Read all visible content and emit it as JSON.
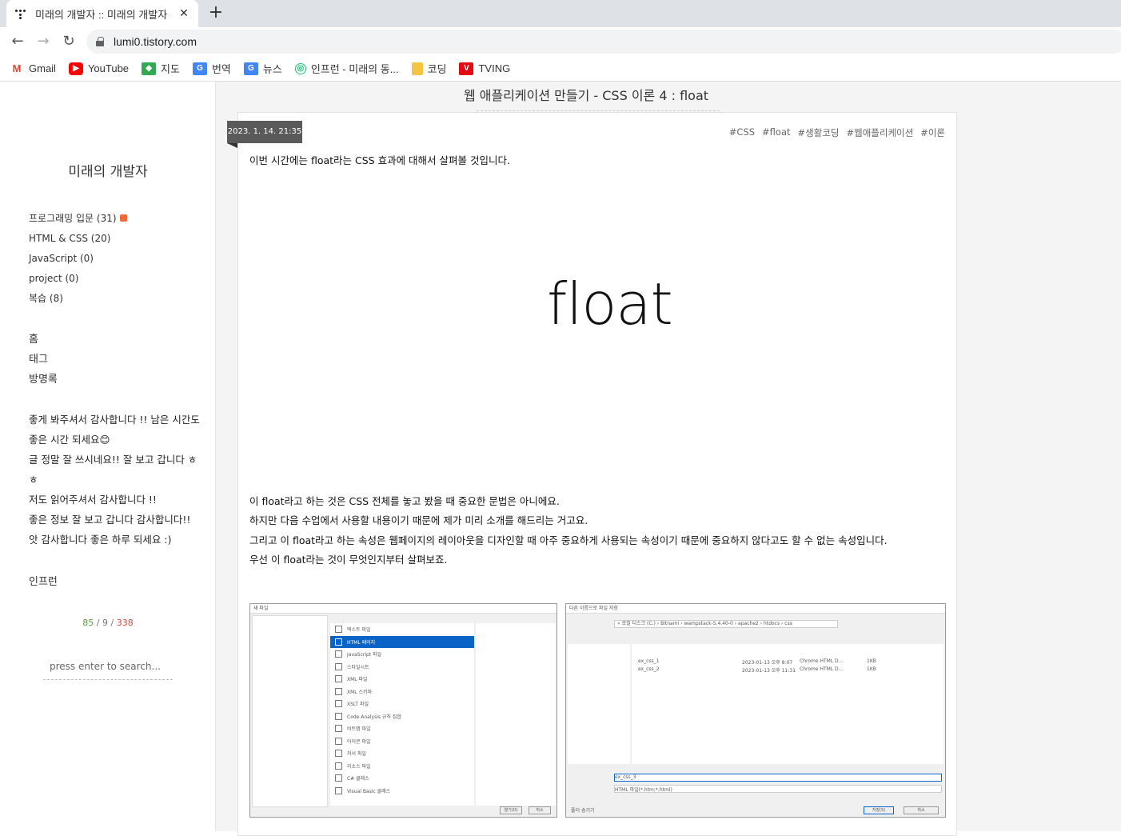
{
  "browser": {
    "tab_title": "미래의 개발자 :: 미래의 개발자",
    "url": "lumi0.tistory.com",
    "bookmarks": [
      {
        "label": "Gmail",
        "icon": "gmail-icon",
        "color": "#ea4335"
      },
      {
        "label": "YouTube",
        "icon": "youtube-icon",
        "color": "#ff0000"
      },
      {
        "label": "지도",
        "icon": "maps-icon",
        "color": "#34a853"
      },
      {
        "label": "번역",
        "icon": "translate-icon",
        "color": "#4285f4"
      },
      {
        "label": "뉴스",
        "icon": "news-icon",
        "color": "#4285f4"
      },
      {
        "label": "인프런 - 미래의 동...",
        "icon": "inflearn-icon",
        "color": "#1dc078"
      },
      {
        "label": "코딩",
        "icon": "folder-icon",
        "color": "#f5c542"
      },
      {
        "label": "TVING",
        "icon": "tving-icon",
        "color": "#e50914"
      }
    ]
  },
  "sidebar": {
    "blog_title": "미래의 개발자",
    "categories": [
      {
        "label": "프로그래밍 입문 (31)",
        "new": true
      },
      {
        "label": "HTML & CSS (20)",
        "new": false
      },
      {
        "label": "JavaScript (0)",
        "new": false
      },
      {
        "label": "project (0)",
        "new": false
      },
      {
        "label": "복습 (8)",
        "new": false
      }
    ],
    "menu": [
      "홈",
      "태그",
      "방명록"
    ],
    "recent_comments": [
      "좋게 봐주셔서 감사합니다 !! 남은 시간도",
      "좋은 시간 되세요😊",
      "글 정말 잘 쓰시네요!! 잘 보고 갑니다 ㅎ",
      "ㅎ",
      "저도 읽어주셔서 감사합니다 !!",
      "좋은 정보 잘 보고 갑니다 감사합니다!!",
      "앗 감사합니다 좋은 하루 되세요 :)"
    ],
    "inflearn_label": "인프런",
    "counter": {
      "total": "85",
      "today": "9",
      "yesterday": "338"
    },
    "search_placeholder": "press enter to search..."
  },
  "post": {
    "title": "웹 애플리케이션 만들기 - CSS 이론 4 : float",
    "date": "2023. 1. 14. 21:35",
    "tags": [
      "#CSS",
      "#float",
      "#생활코딩",
      "#웹애플리케이션",
      "#이론"
    ],
    "intro": "이번 시간에는  float라는 CSS 효과에 대해서 살펴볼 것입니다.",
    "hero_word": "float",
    "paragraphs": [
      "이 float라고 하는 것은 CSS 전체를 놓고 봤을 때 중요한 문법은 아니에요.",
      "하지만 다음 수업에서 사용할 내용이기 때문에 제가 미리 소개를 해드리는 거고요.",
      "그리고 이 float라고 하는 속성은 웹페이지의 레이아웃을 디자인할 때 아주 중요하게 사용되는 속성이기 때문에 중요하지 않다고도 할 수 없는 속성입니다.",
      "우선 이 float라는 것이 무엇인지부터 살펴보죠."
    ],
    "screenshot1": {
      "window_title": "새 파일",
      "items": [
        "텍스트 파일",
        "HTML 페이지",
        "JavaScript 파일",
        "스타일시트",
        "XML 파일",
        "XML 스키마",
        "XSLT 파일",
        "Code Analysis 규칙 집합",
        "비트맵 파일",
        "아이콘 파일",
        "커서 파일",
        "리소스 파일",
        "C# 클래스",
        "Visual Basic 클래스"
      ],
      "selected_index": 1,
      "open_button": "열기(O)",
      "cancel_button": "취소"
    },
    "screenshot2": {
      "window_title": "다른 이름으로 파일 저장",
      "path": "« 로컬 디스크 (C:) › Bitnami › wampstack-5.4.40-0 › apache2 › htdocs › css",
      "files": [
        {
          "name": "ex_css_1",
          "date": "2023-01-13 오후 8:07",
          "type": "Chrome HTML D...",
          "size": "1KB"
        },
        {
          "name": "ex_css_2",
          "date": "2023-01-13 오후 11:31",
          "type": "Chrome HTML D...",
          "size": "1KB"
        }
      ],
      "filename_value": "ex_css_3",
      "filetype_value": "HTML 파일(*.htm;*.html)",
      "save_button": "저장(S)",
      "cancel_button": "취소",
      "hide_folders": "폴더 숨기기"
    }
  }
}
